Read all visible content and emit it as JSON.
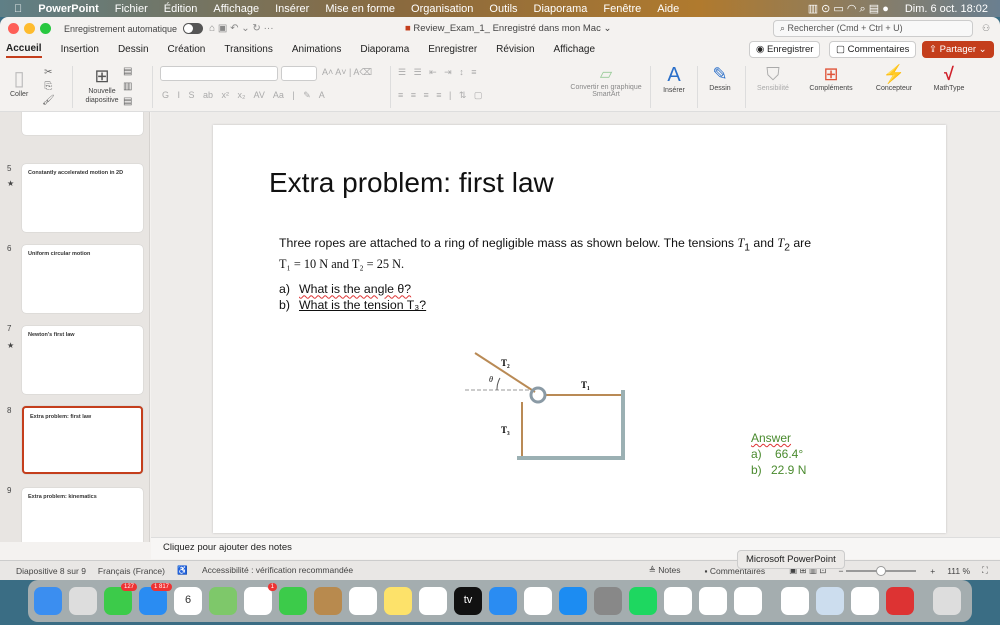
{
  "menubar": {
    "app": "PowerPoint",
    "items": [
      "Fichier",
      "Édition",
      "Affichage",
      "Insérer",
      "Mise en forme",
      "Organisation",
      "Outils",
      "Diaporama",
      "Fenêtre",
      "Aide"
    ],
    "clock": "Dim. 6 oct. 18:02"
  },
  "titlebar": {
    "autosave": "Enregistrement automatique",
    "doc_title": "Review_Exam_1_ Enregistré dans mon Mac ⌄",
    "search_placeholder": "Rechercher (Cmd + Ctrl + U)"
  },
  "tabs": [
    "Accueil",
    "Insertion",
    "Dessin",
    "Création",
    "Transitions",
    "Animations",
    "Diaporama",
    "Enregistrer",
    "Révision",
    "Affichage"
  ],
  "tab_buttons": {
    "record": "Enregistrer",
    "comments": "Commentaires",
    "share": "Partager"
  },
  "ribbon": {
    "paste": "Coller",
    "new_slide": "Nouvelle diapositive",
    "smartart": "Convertir en graphique SmartArt",
    "insert": "Insérer",
    "draw": "Dessin",
    "sensitivity": "Sensibilité",
    "addins": "Compléments",
    "designer": "Concepteur",
    "mathtype": "MathType"
  },
  "thumbnails": [
    {
      "num": "5",
      "title": "Constantly accelerated motion in 2D",
      "star": true
    },
    {
      "num": "6",
      "title": "Uniform circular motion",
      "star": false
    },
    {
      "num": "7",
      "title": "Newton's first law",
      "star": true
    },
    {
      "num": "8",
      "title": "Extra problem: first law",
      "star": false,
      "selected": true
    },
    {
      "num": "9",
      "title": "Extra problem: kinematics",
      "star": false
    }
  ],
  "slide": {
    "title": "Extra problem: first law",
    "intro1": "Three ropes are attached to a ring of negligible mass as shown below. The tensions ",
    "T1": "T",
    "sub1": "1",
    "and": " and ",
    "T2": "T",
    "sub2": "2",
    "are": " are",
    "eq": "T₁ = 10 N and T₂ = 25 N.",
    "qa_label": "a)",
    "qa": "What is the angle θ?",
    "qb_label": "b)",
    "qb": "What is the tension T₃?",
    "diagram_labels": {
      "t1": "T₁",
      "t2": "T₂",
      "t3": "T₃",
      "theta": "θ"
    },
    "answer": {
      "heading": "Answer",
      "a_label": "a)",
      "a": "66.4°",
      "b_label": "b)",
      "b": "22.9 N"
    }
  },
  "notes_placeholder": "Cliquez pour ajouter des notes",
  "status": {
    "slide": "Diapositive 8 sur 9",
    "language": "Français (France)",
    "accessibility": "Accessibilité : vérification recommandée",
    "notes": "Notes",
    "comments": "Commentaires",
    "zoom": "111 %"
  },
  "tooltip": "Microsoft PowerPoint",
  "dock": {
    "apps": [
      {
        "name": "finder",
        "color": "#3b8ef0"
      },
      {
        "name": "launchpad",
        "color": "#ddd"
      },
      {
        "name": "messages",
        "color": "#3ccb4a",
        "badge": "127"
      },
      {
        "name": "mail",
        "color": "#2a8cf2",
        "badge": "1 817"
      },
      {
        "name": "calendar",
        "color": "#fff",
        "label": "6"
      },
      {
        "name": "maps",
        "color": "#7ec86a"
      },
      {
        "name": "photos",
        "color": "#fff",
        "badge": "1"
      },
      {
        "name": "facetime",
        "color": "#3ccb4a"
      },
      {
        "name": "contacts",
        "color": "#b88a4e"
      },
      {
        "name": "reminders",
        "color": "#fff"
      },
      {
        "name": "notes",
        "color": "#fde26a"
      },
      {
        "name": "freeform",
        "color": "#fff"
      },
      {
        "name": "tv",
        "color": "#111",
        "label": "tv"
      },
      {
        "name": "safari",
        "color": "#2a8cf2"
      },
      {
        "name": "chrome",
        "color": "#fff"
      },
      {
        "name": "app-store",
        "color": "#1c8cf2"
      },
      {
        "name": "system-settings",
        "color": "#888"
      },
      {
        "name": "spotify",
        "color": "#1ed760"
      },
      {
        "name": "word",
        "color": "#fff"
      },
      {
        "name": "outlook",
        "color": "#fff"
      },
      {
        "name": "onedrive",
        "color": "#fff"
      },
      {
        "name": "powerpoint",
        "color": "#fff"
      },
      {
        "name": "preview",
        "color": "#cde"
      },
      {
        "name": "excel",
        "color": "#fff"
      },
      {
        "name": "photo-booth",
        "color": "#d33"
      },
      {
        "name": "trash",
        "color": "#ddd"
      }
    ]
  },
  "colors": {
    "accent": "#c43e1c",
    "answer": "#4a8a2e",
    "rope": "#b98a55",
    "wall": "#9bb0b3"
  }
}
